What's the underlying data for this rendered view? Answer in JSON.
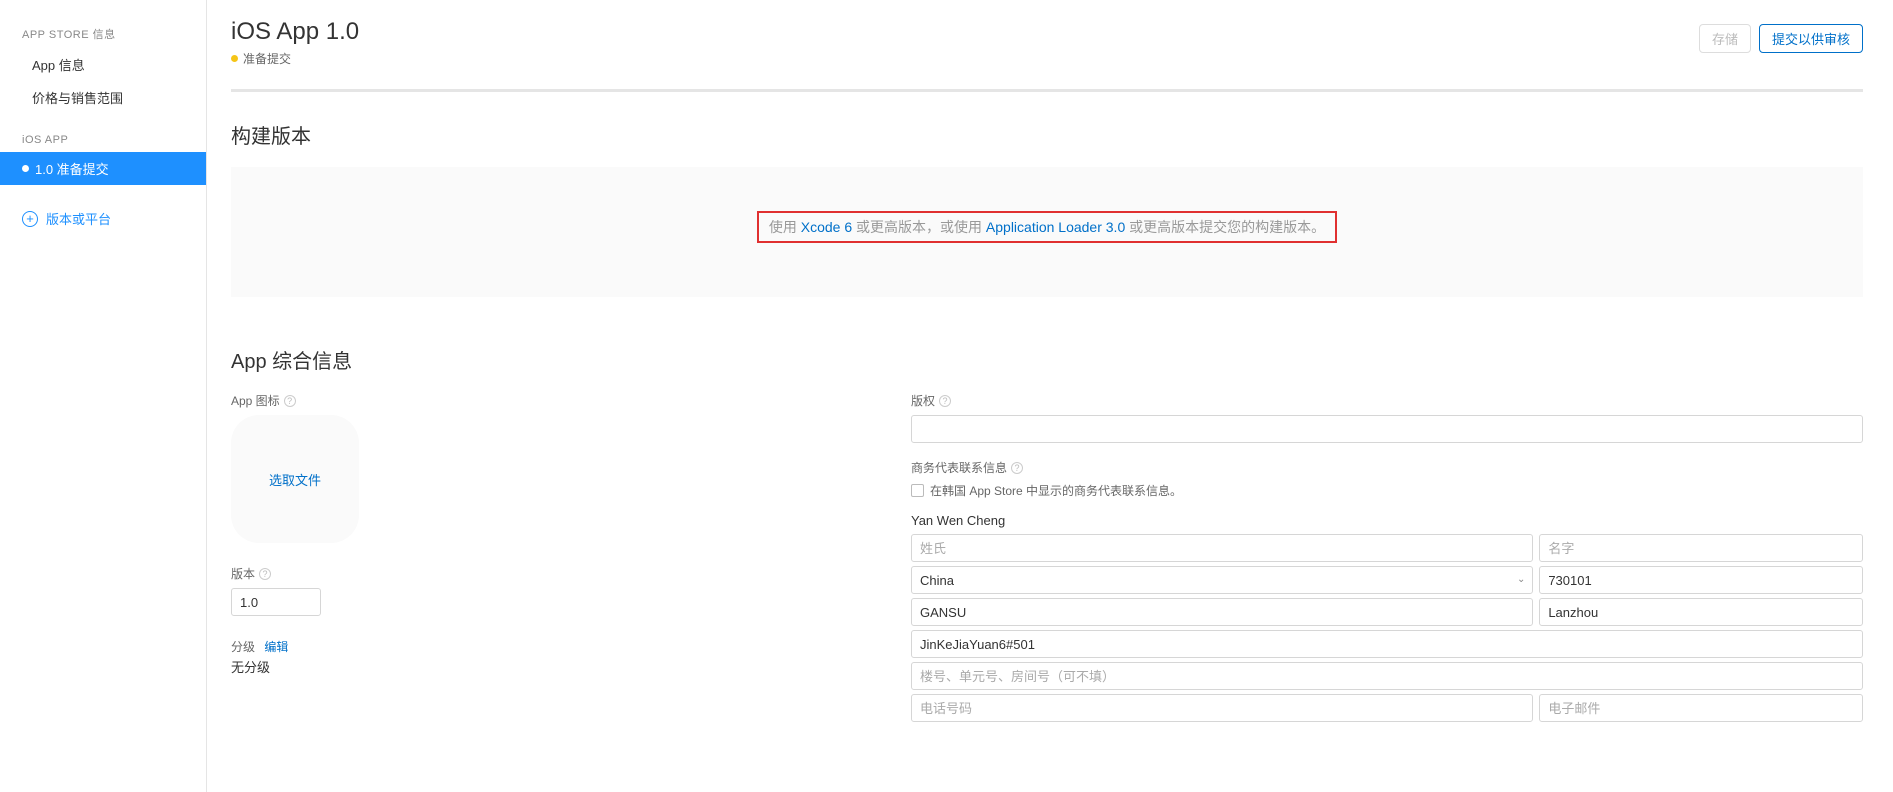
{
  "sidebar": {
    "section_app_store": "APP STORE 信息",
    "app_info": "App 信息",
    "pricing": "价格与销售范围",
    "section_ios": "iOS APP",
    "version_item": "1.0 准备提交",
    "add_version": "版本或平台"
  },
  "header": {
    "title": "iOS App 1.0",
    "status": "准备提交",
    "save": "存储",
    "submit": "提交以供审核"
  },
  "build": {
    "section_title": "构建版本",
    "text_prefix": "使用 ",
    "link1": "Xcode 6",
    "text_mid": " 或更高版本，或使用 ",
    "link2": "Application Loader 3.0",
    "text_suffix": " 或更高版本提交您的构建版本。"
  },
  "info": {
    "section_title": "App 综合信息",
    "icon_label": "App 图标",
    "choose_file": "选取文件",
    "version_label": "版本",
    "version_value": "1.0",
    "rating_label": "分级",
    "rating_edit": "编辑",
    "rating_value": "无分级"
  },
  "right": {
    "copyright_label": "版权",
    "contact_label": "商务代表联系信息",
    "contact_checkbox": "在韩国 App Store 中显示的商务代表联系信息。",
    "contact_name": "Yan Wen Cheng",
    "last_name_ph": "姓氏",
    "first_name_ph": "名字",
    "country_value": "China",
    "postal_value": "730101",
    "state_value": "GANSU",
    "city_value": "Lanzhou",
    "address_value": "JinKeJiaYuan6#501",
    "address2_ph": "楼号、单元号、房间号（可不填）",
    "phone_ph": "电话号码",
    "email_ph": "电子邮件"
  }
}
